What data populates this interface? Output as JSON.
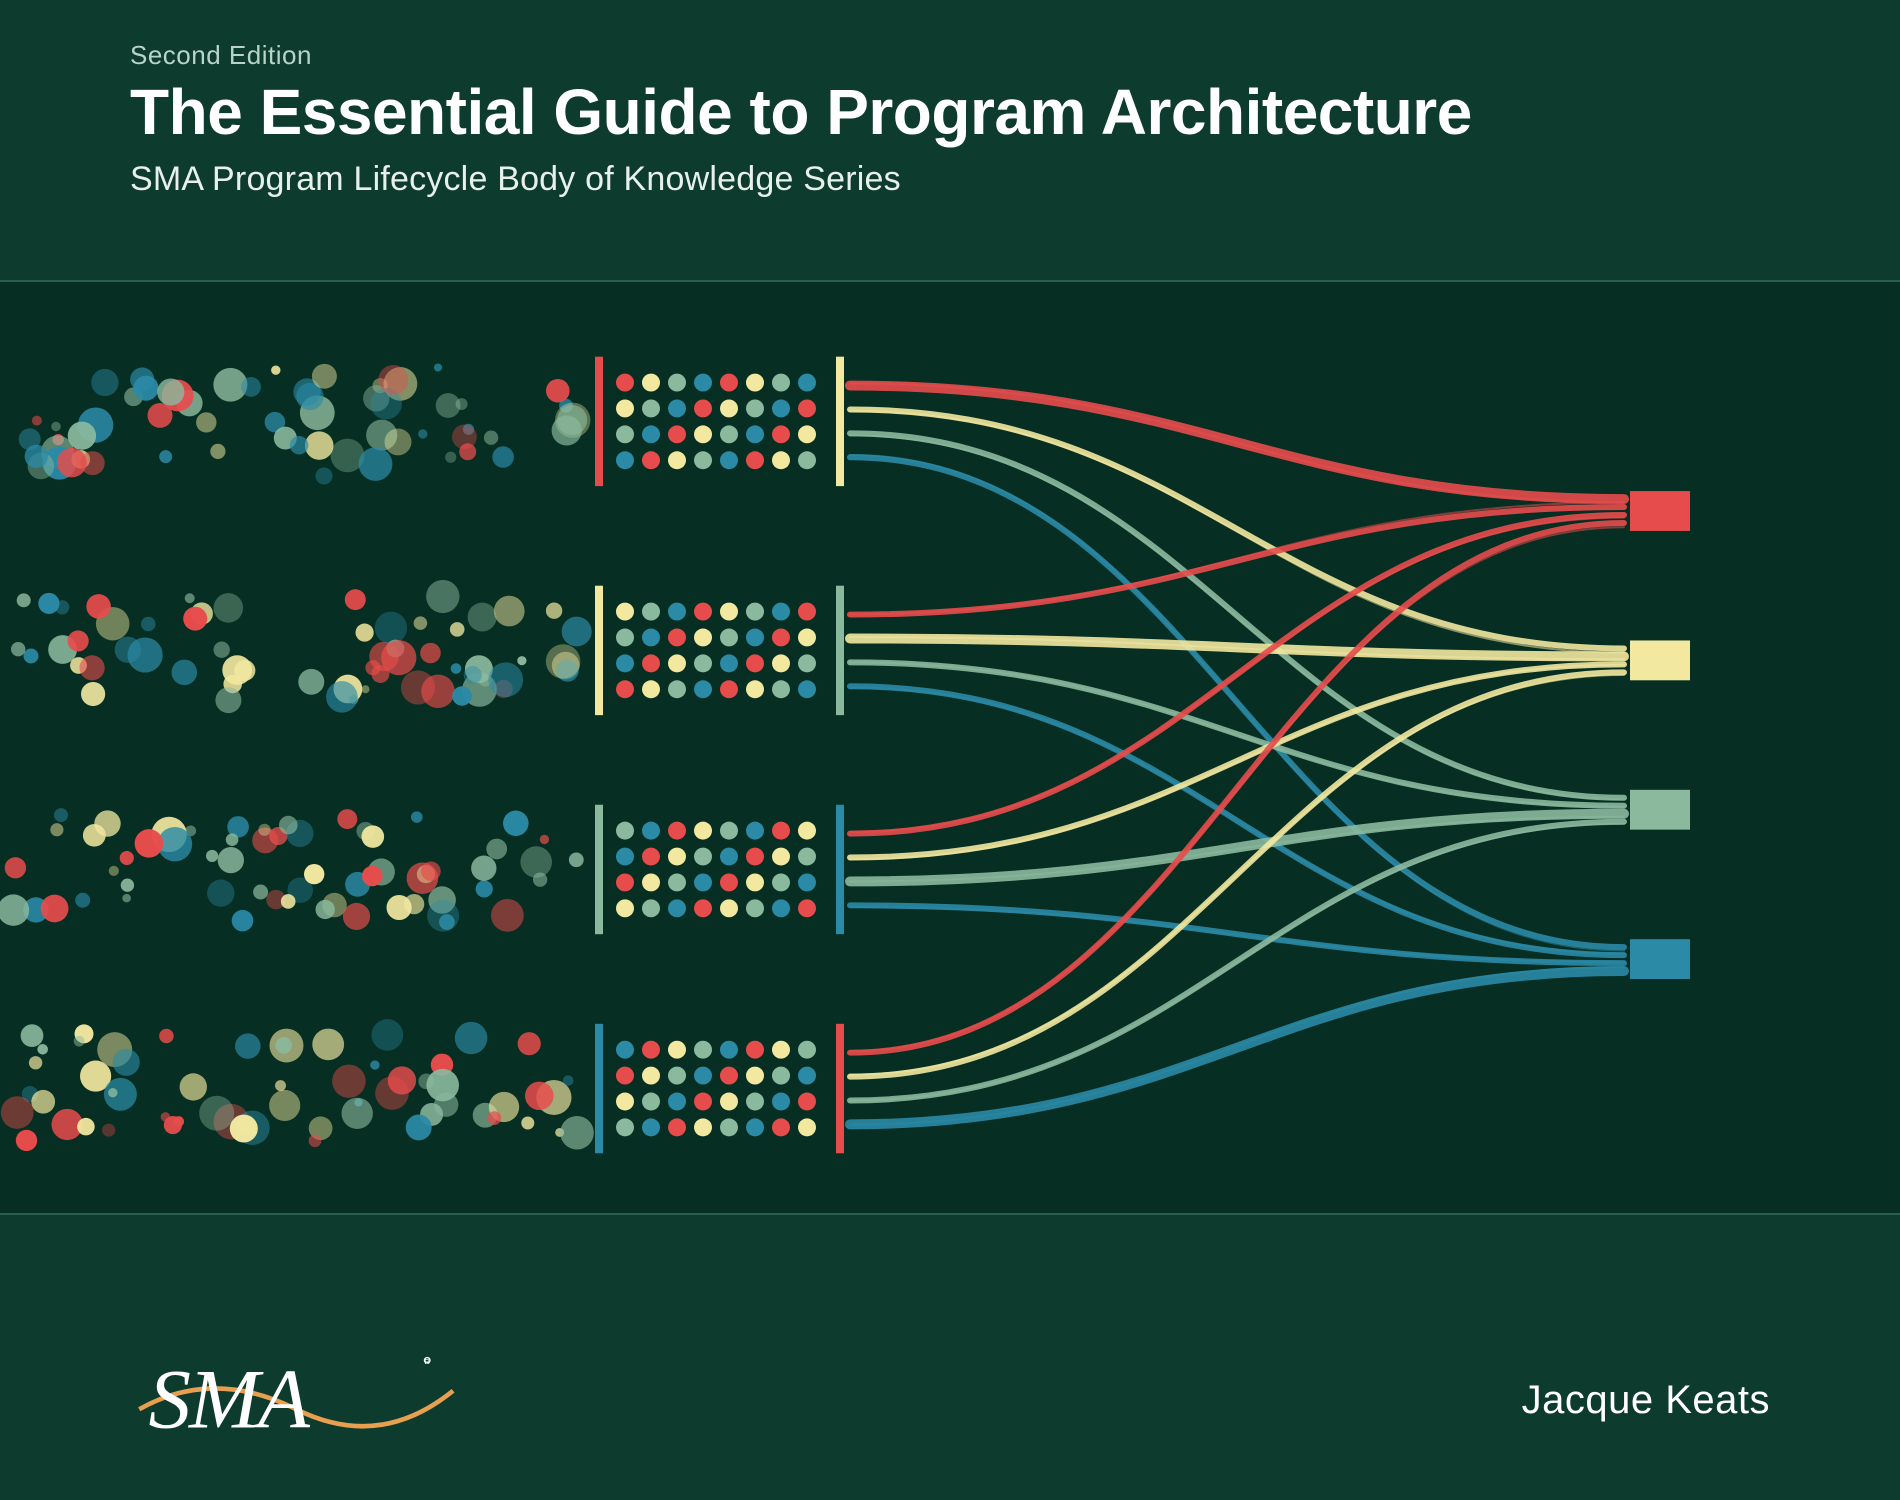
{
  "edition": "Second Edition",
  "title": "The Essential Guide to Program Architecture",
  "subtitle": "SMA Program Lifecycle Body of Knowledge Series",
  "author": "Jacque Keats",
  "logo_text": "SMA",
  "palette": {
    "red": "#e74c4c",
    "yellow": "#f2e8a0",
    "green": "#8bb99e",
    "teal": "#2b8aa6",
    "bg_dark": "#062e22",
    "bg": "#0d3b2e"
  }
}
